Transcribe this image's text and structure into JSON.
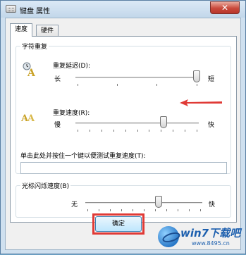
{
  "window": {
    "title": "键盘 属性",
    "close_symbol": "✕"
  },
  "tabs": [
    {
      "label": "速度",
      "active": true
    },
    {
      "label": "硬件",
      "active": false
    }
  ],
  "char_repeat": {
    "group_title": "字符重复",
    "delay": {
      "label": "重复延迟(D):",
      "min_label": "长",
      "max_label": "短",
      "value_percent": 100
    },
    "rate": {
      "label": "重复速度(R):",
      "min_label": "慢",
      "max_label": "快",
      "value_percent": 72
    },
    "test_label": "单击此处并按住一个键以便测试重复速度(T):",
    "test_value": ""
  },
  "cursor_blink": {
    "group_title": "光标闪烁速度(B)",
    "min_label": "无",
    "max_label": "快",
    "value_percent": 63
  },
  "buttons": {
    "ok": "确定"
  },
  "annotation": {
    "arrow_color": "#e03a36",
    "box_color": "#e03a36"
  },
  "watermark": {
    "brand": "win7下载吧",
    "url": "www.8495.cn"
  },
  "icons": [
    "keyboard-icon",
    "repeat-delay-icon",
    "repeat-rate-icon",
    "close-icon"
  ]
}
